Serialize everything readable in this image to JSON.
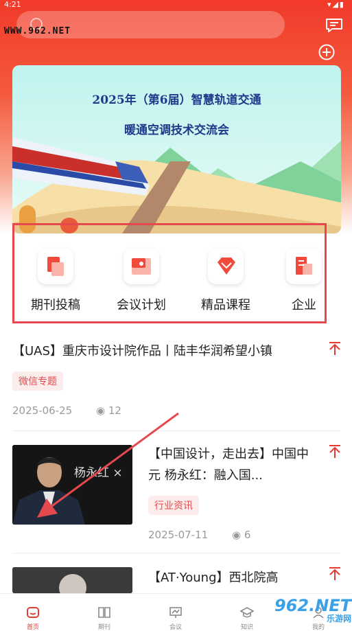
{
  "status_bar": {
    "time": "4:21",
    "icons": "▾◢▮"
  },
  "search": {
    "placeholder": ""
  },
  "watermark": "WWW.962.NET",
  "banner": {
    "line1": "2025年（第6届）智慧轨道交通",
    "line2": "暖通空调技术交流会"
  },
  "quick_links": [
    {
      "label": "期刊投稿"
    },
    {
      "label": "会议计划"
    },
    {
      "label": "精品课程"
    },
    {
      "label": "企业"
    }
  ],
  "articles": [
    {
      "title": "【UAS】重庆市设计院作品丨陆丰华润希望小镇",
      "tag": "微信专题",
      "date": "2025-06-25",
      "views": "12"
    },
    {
      "title": "【中国设计，走出去】中国中元 杨永红：融入国...",
      "tag": "行业资讯",
      "date": "2025-07-11",
      "views": "6",
      "thumb_caption": "杨永红 ×"
    },
    {
      "title": "【AT·Young】西北院高",
      "tag": "",
      "date": "",
      "views": ""
    }
  ],
  "tabs": [
    {
      "label": "首页"
    },
    {
      "label": "期刊"
    },
    {
      "label": "会议"
    },
    {
      "label": "知识"
    },
    {
      "label": "我的"
    }
  ],
  "bottom_watermark": {
    "brand": "962.NET",
    "sub": "乐游网"
  },
  "colors": {
    "accent": "#e53935",
    "tag_bg": "#fdecec",
    "tag_text": "#e24c4c",
    "highlight_box": "#e5484d"
  }
}
